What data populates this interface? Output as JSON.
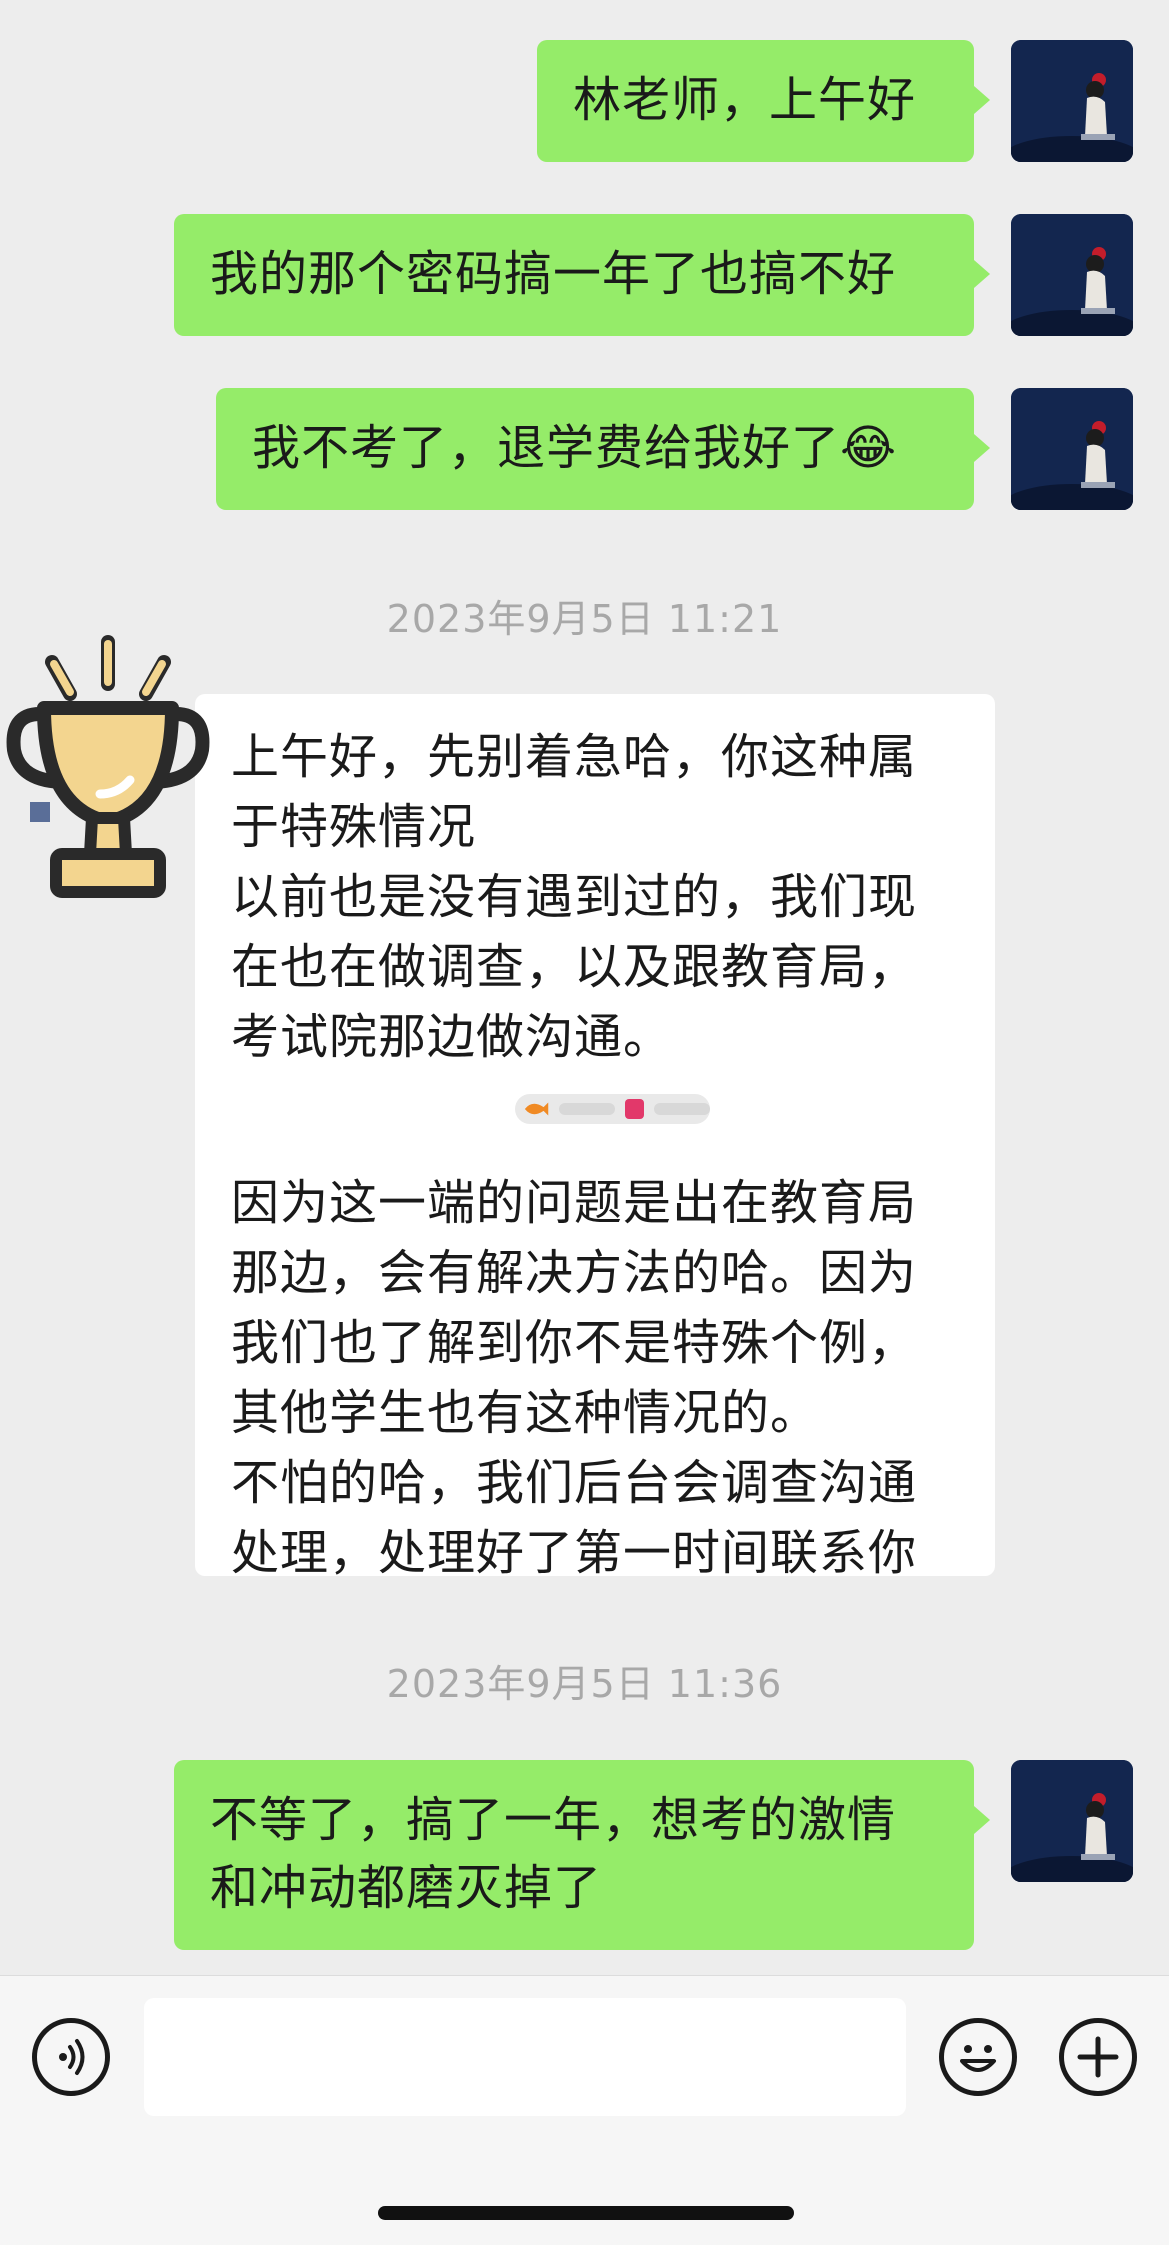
{
  "messages": [
    {
      "sender": "me",
      "text": "林老师，上午好"
    },
    {
      "sender": "me",
      "text": "我的那个密码搞一年了也搞不好"
    },
    {
      "sender": "me",
      "text": "我不考了，退学费给我好了",
      "emoji": "😂"
    },
    {
      "sender": "time",
      "text": "2023年9月5日 11:21"
    },
    {
      "sender": "them",
      "lines": [
        "上午好，先别着急哈，你这种属于特殊情况",
        "以前也是没有遇到过的，我们现在也在做调查，以及跟教育局，考试院那边做沟通。"
      ],
      "lines2": [
        "因为这一端的问题是出在教育局那边，会有解决方法的哈。因为我们也了解到你不是特殊个例，其他学生也有这种情况的。",
        "不怕的哈，我们后台会调查沟通处理，处理好了第一时间联系你"
      ]
    },
    {
      "sender": "time",
      "text": "2023年9月5日 11:36"
    },
    {
      "sender": "me",
      "text": "不等了，搞了一年，想考的激情和冲动都磨灭掉了"
    }
  ],
  "input_bar": {
    "voice_icon": "voice-icon",
    "emoji_icon": "emoji-icon",
    "plus_icon": "plus-icon",
    "placeholder": ""
  },
  "colors": {
    "me_bubble": "#95ec69",
    "them_bubble": "#ffffff",
    "background": "#ededed"
  }
}
